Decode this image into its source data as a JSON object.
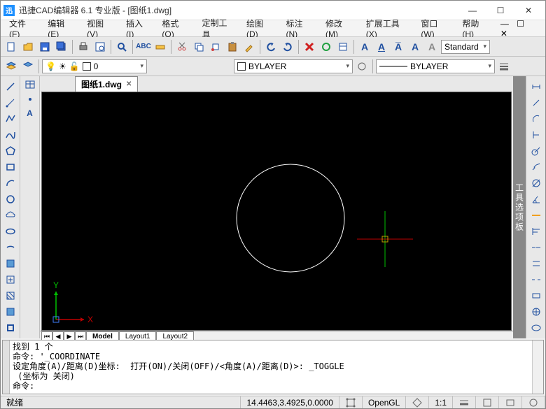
{
  "window": {
    "title": "迅捷CAD编辑器 6.1 专业版  - [图纸1.dwg]",
    "app_abbrev": "迅"
  },
  "menu": {
    "file": "文件(F)",
    "edit": "编辑(E)",
    "view": "视图(V)",
    "insert": "插入(I)",
    "format": "格式(O)",
    "custom": "定制工具",
    "draw": "绘图(D)",
    "annotate": "标注(N)",
    "modify": "修改(M)",
    "extend": "扩展工具(X)",
    "window": "窗口(W)",
    "help": "帮助(H)"
  },
  "toolbar": {
    "style_name": "Standard",
    "layer": "0",
    "linetype": "BYLAYER",
    "lineweight": "BYLAYER"
  },
  "doc_tab": {
    "name": "图纸1.dwg"
  },
  "layout_tabs": {
    "model": "Model",
    "layout1": "Layout1",
    "layout2": "Layout2"
  },
  "axis": {
    "x": "X",
    "y": "Y"
  },
  "side_panel": {
    "label": "工具选项板"
  },
  "command": {
    "lines": "找到 1 个\n命令: '_COORDINATE\n设定角度(A)/距离(D)坐标:  打开(ON)/关闭(OFF)/<角度(A)/距离(D)>: _TOGGLE\n (坐标为 关闭)\n命令:"
  },
  "status": {
    "ready": "就绪",
    "coords": "14.4463,3.4925,0.0000",
    "opengl": "OpenGL",
    "scale": "1:1"
  },
  "chart_data": {
    "type": "scatter",
    "title": "CAD drawing canvas",
    "series": [
      {
        "name": "circle",
        "shape": "circle",
        "center_approx": [
          10.5,
          4.5
        ],
        "radius_approx": 2.8
      }
    ],
    "cursor_world_coords": [
      14.4463,
      3.4925,
      0.0
    ],
    "ucs_origin_visible": true
  }
}
